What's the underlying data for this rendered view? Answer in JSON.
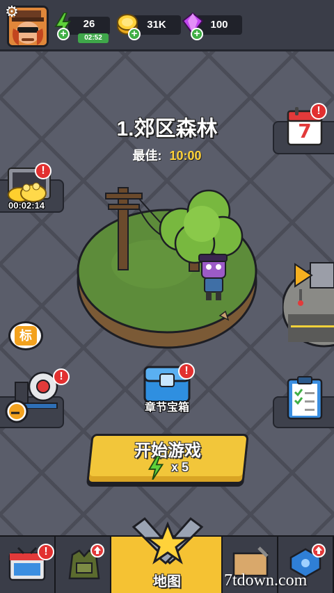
{
  "resources": {
    "energy_value": "26",
    "energy_timer": "02:52",
    "gold_value": "31K",
    "gem_value": "100"
  },
  "level": {
    "title": "1.郊区森林",
    "best_label": "最佳:",
    "best_value": "10:00"
  },
  "side": {
    "treasure_timer": "00:02:14",
    "alert_glyph": "!",
    "marker_label": "标"
  },
  "calendar": {
    "day": "7"
  },
  "chest": {
    "label": "章节宝箱"
  },
  "start": {
    "label": "开始游戏",
    "cost": "x 5"
  },
  "nav": {
    "active_label": "地图"
  },
  "watermark": "7tdown.com",
  "colors": {
    "accent_gold": "#f5c233",
    "alert_red": "#e23030",
    "grass_green": "#5d8c3a",
    "energy_green": "#3fa74a",
    "gem_purple": "#b03ae0"
  }
}
